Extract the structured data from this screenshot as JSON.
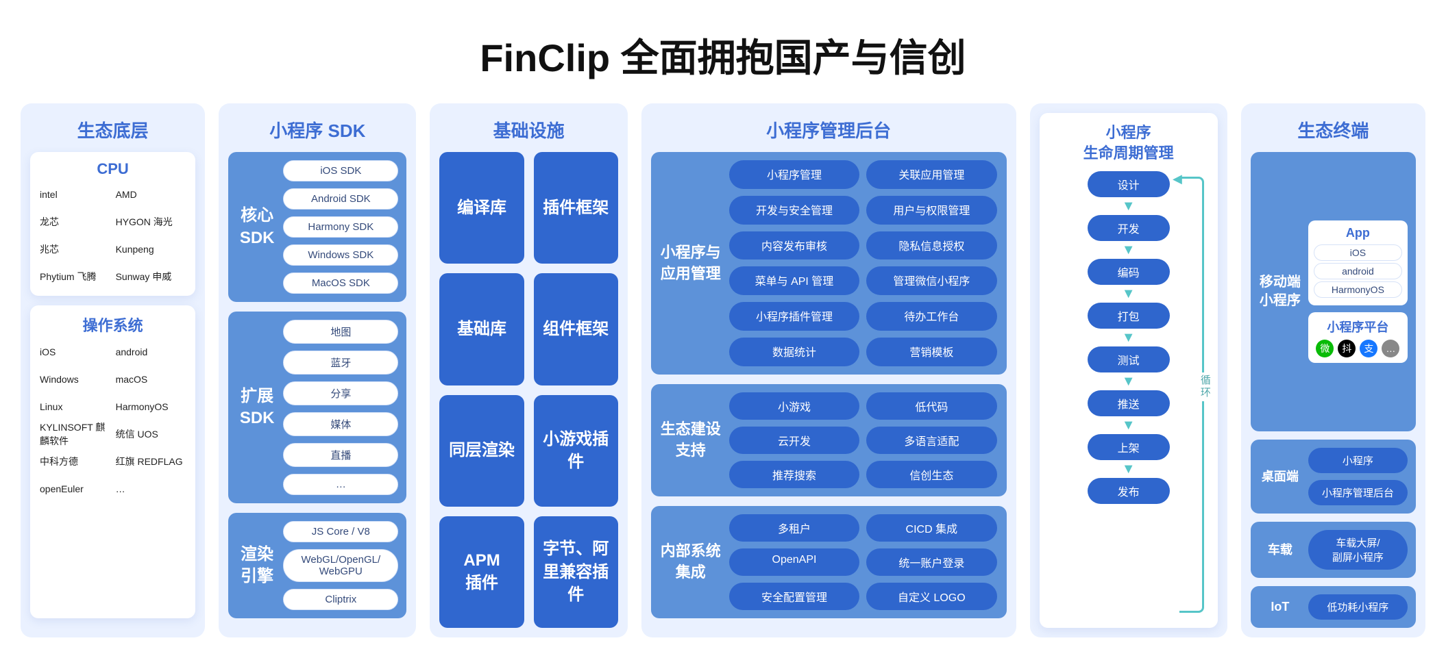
{
  "title": "FinClip 全面拥抱国产与信创",
  "col1": {
    "header": "生态底层",
    "cpu": {
      "header": "CPU",
      "items": [
        "intel",
        "AMD",
        "龙芯",
        "HYGON 海光",
        "兆芯",
        "Kunpeng",
        "Phytium 飞腾",
        "Sunway 申威"
      ]
    },
    "os": {
      "header": "操作系统",
      "items": [
        "iOS",
        "android",
        "Windows",
        "macOS",
        "Linux",
        "HarmonyOS",
        "KYLINSOFT 麒麟软件",
        "统信 UOS",
        "中科方德",
        "红旗 REDFLAG",
        "openEuler",
        "…"
      ]
    }
  },
  "col2": {
    "header": "小程序 SDK",
    "groups": [
      {
        "label": "核心\nSDK",
        "items": [
          "iOS SDK",
          "Android SDK",
          "Harmony SDK",
          "Windows SDK",
          "MacOS SDK"
        ]
      },
      {
        "label": "扩展\nSDK",
        "items": [
          "地图",
          "蓝牙",
          "分享",
          "媒体",
          "直播",
          "…"
        ]
      },
      {
        "label": "渲染\n引擎",
        "items": [
          "JS Core / V8",
          "WebGL/OpenGL/\nWebGPU",
          "Cliptrix"
        ]
      }
    ]
  },
  "col3": {
    "header": "基础设施",
    "blocks": [
      "编译库",
      "插件框架",
      "基础库",
      "组件框架",
      "同层渲染",
      "小游戏插件",
      "APM\n插件",
      "字节、阿里兼容插件"
    ]
  },
  "col4": {
    "header": "小程序管理后台",
    "groups": [
      {
        "label": "小程序与应用管理",
        "items": [
          "小程序管理",
          "关联应用管理",
          "开发与安全管理",
          "用户与权限管理",
          "内容发布审核",
          "隐私信息授权",
          "菜单与 API 管理",
          "管理微信小程序",
          "小程序插件管理",
          "待办工作台",
          "数据统计",
          "营销模板"
        ]
      },
      {
        "label": "生态建设支持",
        "items": [
          "小游戏",
          "低代码",
          "云开发",
          "多语言适配",
          "推荐搜索",
          "信创生态"
        ]
      },
      {
        "label": "内部系统集成",
        "items": [
          "多租户",
          "CICD 集成",
          "OpenAPI",
          "统一账户登录",
          "安全配置管理",
          "自定义 LOGO"
        ]
      }
    ]
  },
  "col5": {
    "title": "小程序\n生命周期管理",
    "steps": [
      "设计",
      "开发",
      "编码",
      "打包",
      "测试",
      "推送",
      "上架",
      "发布"
    ],
    "loop_label": "循环"
  },
  "col6": {
    "header": "生态终端",
    "mobile": {
      "label": "移动端\n小程序",
      "app_header": "App",
      "app_os": [
        "iOS",
        "android",
        "HarmonyOS"
      ],
      "platform_header": "小程序平台",
      "platform_icons": [
        "微",
        "抖",
        "支",
        "…"
      ]
    },
    "desktop": {
      "label": "桌面端",
      "items": [
        "小程序",
        "小程序管理后台"
      ]
    },
    "car": {
      "label": "车载",
      "items": [
        "车载大屏/\n副屏小程序"
      ]
    },
    "iot": {
      "label": "IoT",
      "items": [
        "低功耗小程序"
      ]
    }
  }
}
